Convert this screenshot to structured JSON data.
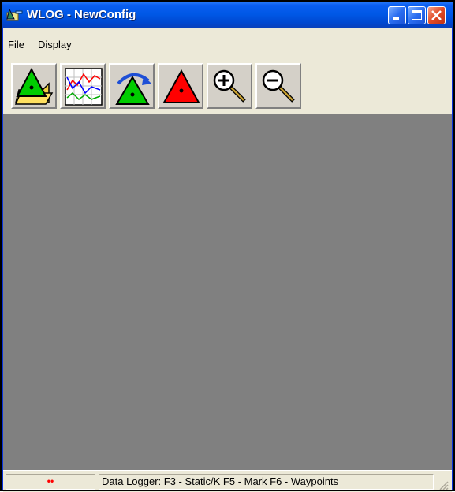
{
  "window": {
    "title": "WLOG - NewConfig",
    "controls": {
      "minimize": "minimize-icon",
      "maximize": "maximize-icon",
      "close": "close-icon"
    }
  },
  "menu": {
    "items": [
      {
        "label": "File"
      },
      {
        "label": "Display"
      }
    ]
  },
  "toolbar": {
    "buttons": [
      {
        "icon": "open-config-icon"
      },
      {
        "icon": "graph-icon"
      },
      {
        "icon": "rotate-marker-icon"
      },
      {
        "icon": "red-marker-icon"
      },
      {
        "icon": "zoom-in-icon"
      },
      {
        "icon": "zoom-out-icon"
      }
    ]
  },
  "statusbar": {
    "indicator": "••",
    "text": "Data Logger:  F3 - Static/K  F5 - Mark  F6 - Waypoints"
  },
  "colors": {
    "titlebar": "#0058e6",
    "client_bg": "#808080",
    "face": "#ece9d8",
    "indicator": "#ff0000"
  }
}
